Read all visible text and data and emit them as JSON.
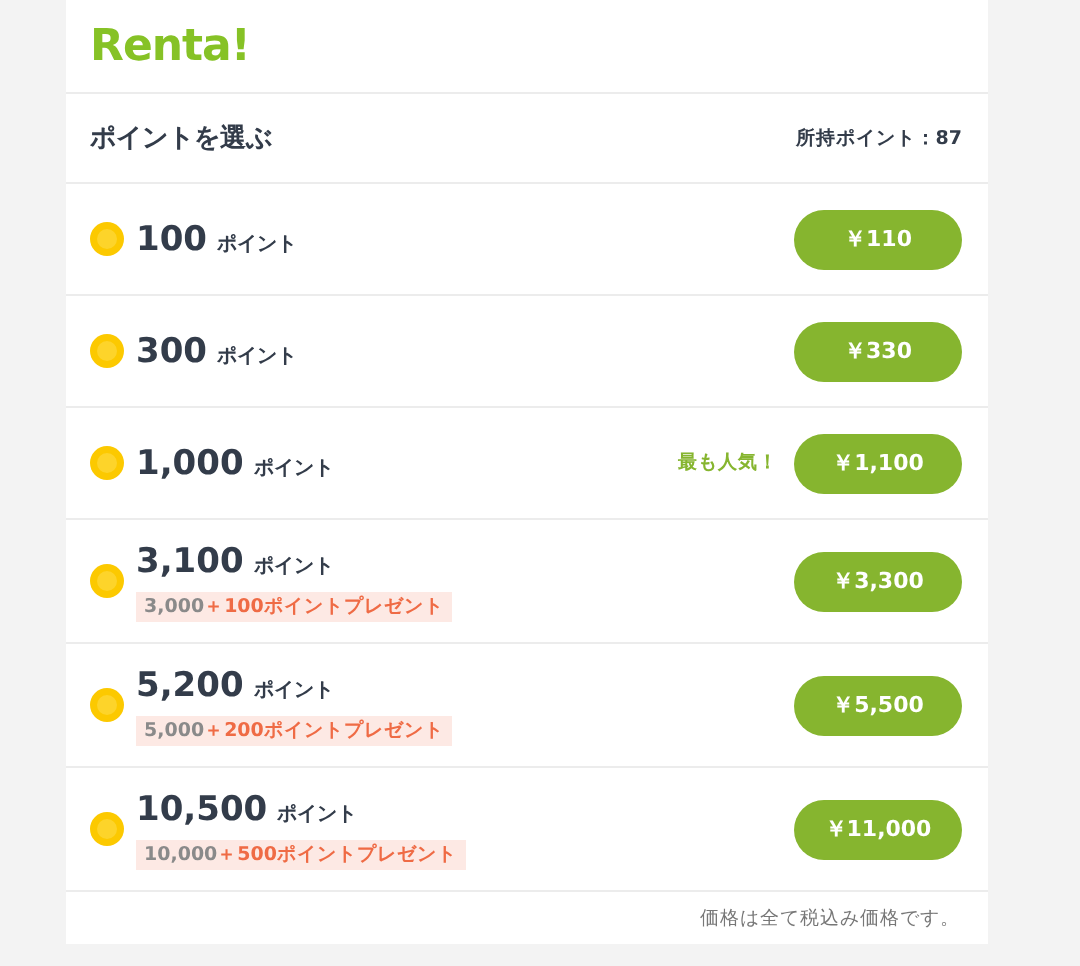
{
  "logo": "Renta!",
  "header": {
    "title": "ポイントを選ぶ",
    "owned": "所持ポイント：87"
  },
  "options": [
    {
      "points": "100",
      "unit": "ポイント",
      "price": "￥110"
    },
    {
      "points": "300",
      "unit": "ポイント",
      "price": "￥330"
    },
    {
      "points": "1,000",
      "unit": "ポイント",
      "price": "￥1,100",
      "badge": "最も人気！"
    },
    {
      "points": "3,100",
      "unit": "ポイント",
      "price": "￥3,300",
      "bonus_base": "3,000",
      "bonus": "＋100ポイントプレゼント"
    },
    {
      "points": "5,200",
      "unit": "ポイント",
      "price": "￥5,500",
      "bonus_base": "5,000",
      "bonus": "＋200ポイントプレゼント"
    },
    {
      "points": "10,500",
      "unit": "ポイント",
      "price": "￥11,000",
      "bonus_base": "10,000",
      "bonus": "＋500ポイントプレゼント"
    }
  ],
  "footer": "価格は全て税込み価格です。"
}
